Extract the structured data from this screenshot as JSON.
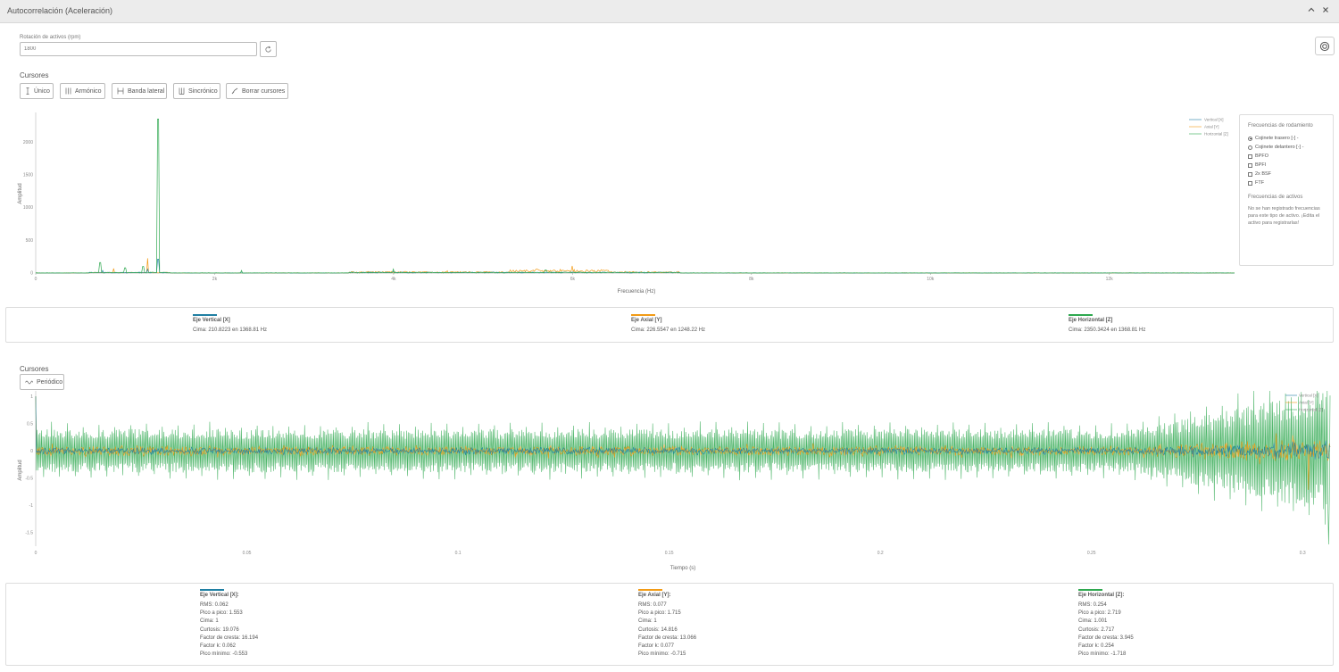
{
  "window": {
    "title": "Autocorrelación (Aceleración)"
  },
  "rpm": {
    "label": "Rotación de activos (rpm)",
    "value": "1800"
  },
  "colors": {
    "vertical": "#1f7fa3",
    "axial": "#f29b16",
    "horizontal": "#2ea84f",
    "grid": "#cccccc"
  },
  "cursors_top": {
    "label": "Cursores",
    "buttons": [
      {
        "label": "Único",
        "icon": "single-cursor-icon"
      },
      {
        "label": "Armónico",
        "icon": "harmonic-cursor-icon"
      },
      {
        "label": "Banda lateral",
        "icon": "sideband-cursor-icon"
      },
      {
        "label": "Sincrónico",
        "icon": "synchronous-cursor-icon"
      },
      {
        "label": "Borrar cursores",
        "icon": "erase-icon"
      }
    ]
  },
  "cursors_bottom": {
    "label": "Cursores",
    "buttons": [
      {
        "label": "Periódico",
        "icon": "periodic-cursor-icon"
      }
    ]
  },
  "bearing_panel": {
    "title": "Frecuencias de rodamiento",
    "options": [
      {
        "label": "Cojinete trasero  [-] -",
        "type": "radio",
        "checked": true
      },
      {
        "label": "Cojinete delantero  [-] -",
        "type": "radio",
        "checked": false
      },
      {
        "label": "BPFO",
        "type": "checkbox",
        "checked": false
      },
      {
        "label": "BPFI",
        "type": "checkbox",
        "checked": false
      },
      {
        "label": "2x BSF",
        "type": "checkbox",
        "checked": false
      },
      {
        "label": "FTF",
        "type": "checkbox",
        "checked": false
      }
    ],
    "asset_title": "Frecuencias de activos",
    "asset_note": "No se han registrado frecuencias para este tipo de activo. ¡Edita el activo para registrarlas!"
  },
  "chart_data": [
    {
      "type": "line",
      "ylabel": "Amplitud",
      "xlabel": "Frecuencia (Hz)",
      "x_ticks": [
        "0",
        "2k",
        "4k",
        "6k",
        "8k",
        "10k",
        "12k"
      ],
      "y_ticks": [
        "0",
        "500",
        "1000",
        "1500",
        "2000"
      ],
      "xlim": [
        0,
        13400
      ],
      "ylim": [
        0,
        2450
      ],
      "legend_position": "top-right",
      "series": [
        {
          "name": "Vertical [X]",
          "peaks": [
            [
              750,
              40
            ],
            [
              1368.81,
              210.8
            ],
            [
              1248.22,
              60
            ],
            [
              4000,
              25
            ]
          ]
        },
        {
          "name": "Axial [Y]",
          "peaks": [
            [
              870,
              70
            ],
            [
              1248.22,
              226.6
            ],
            [
              4600,
              35
            ],
            [
              5600,
              60
            ],
            [
              6000,
              110
            ]
          ]
        },
        {
          "name": "Horizontal [Z]",
          "peaks": [
            [
              720,
              160
            ],
            [
              1000,
              80
            ],
            [
              1200,
              100
            ],
            [
              1368.81,
              2350.3
            ],
            [
              2300,
              40
            ],
            [
              4000,
              60
            ],
            [
              5700,
              50
            ]
          ]
        }
      ]
    },
    {
      "type": "line",
      "ylabel": "Amplitud",
      "xlabel": "Tiempo (s)",
      "x_ticks": [
        "0",
        "0.05",
        "0.1",
        "0.15",
        "0.2",
        "0.25",
        "0.3"
      ],
      "y_ticks": [
        "1",
        "0.5",
        "0",
        "-0.5",
        "-1",
        "-1.5"
      ],
      "xlim": [
        0,
        0.3065
      ],
      "ylim": [
        -1.75,
        1.1
      ],
      "legend_position": "top-right",
      "series": [
        {
          "name": "Vertical [X]",
          "rms": 0.062,
          "min": -0.553,
          "max": 1
        },
        {
          "name": "Axial [Y]",
          "rms": 0.077,
          "min": -0.715,
          "max": 1
        },
        {
          "name": "Horizontal [Z]",
          "rms": 0.254,
          "min": -1.718,
          "max": 1.001
        }
      ]
    }
  ],
  "spectrum_summary": [
    {
      "axis": "Eje Vertical [X]",
      "peak": "Cima:  210.8223 en 1368.81 Hz"
    },
    {
      "axis": "Eje Axial [Y]",
      "peak": "Cima:  226.5547 en 1248.22 Hz"
    },
    {
      "axis": "Eje Horizontal [Z]",
      "peak": "Cima:  2350.3424 en 1368.81 Hz"
    }
  ],
  "waveform_summary": [
    {
      "axis": "Eje Vertical [X]:",
      "lines": [
        "RMS:  0.062",
        "Pico a pico:  1.553",
        "Cima:  1",
        "Curtosis:  19.076",
        "Factor de cresta:  16.194",
        "Factor k:  0.062",
        "Pico mínimo:  -0.553"
      ]
    },
    {
      "axis": "Eje Axial [Y]:",
      "lines": [
        "RMS:  0.077",
        "Pico a pico:  1.715",
        "Cima:  1",
        "Curtosis:  14.816",
        "Factor de cresta:  13.066",
        "Factor k:  0.077",
        "Pico mínimo:  -0.715"
      ]
    },
    {
      "axis": "Eje Horizontal [Z]:",
      "lines": [
        "RMS:  0.254",
        "Pico a pico:  2.719",
        "Cima:  1.001",
        "Curtosis:  2.717",
        "Factor de cresta:  3.945",
        "Factor k:  0.254",
        "Pico mínimo:  -1.718"
      ]
    }
  ]
}
